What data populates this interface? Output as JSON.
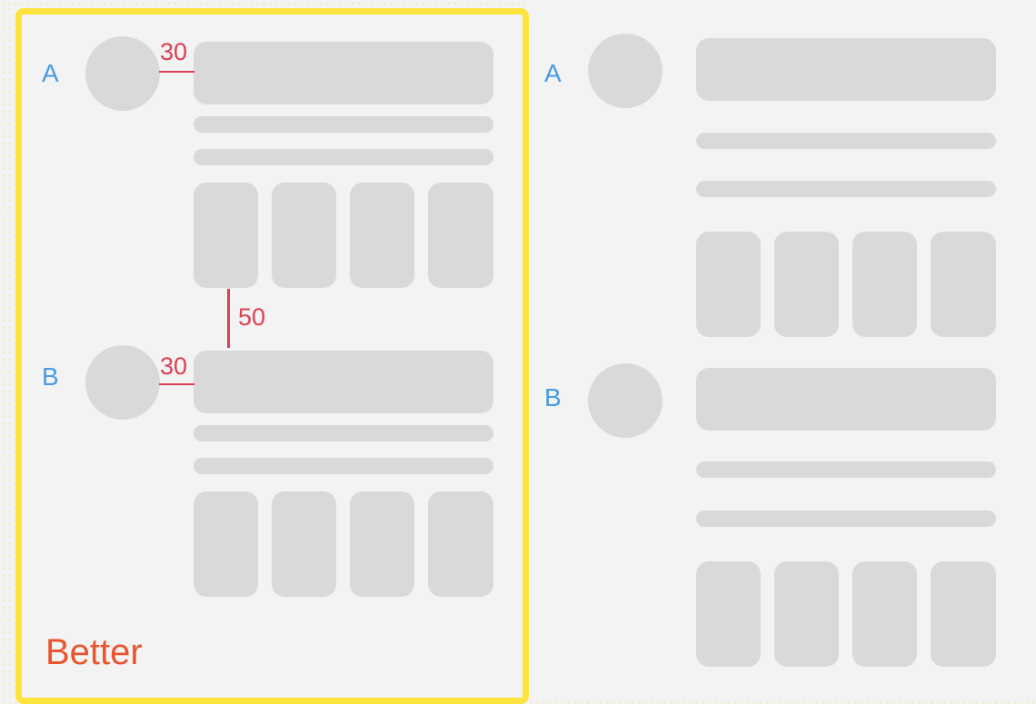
{
  "examples": {
    "left": {
      "verdict": "Better",
      "groups": [
        {
          "label": "A",
          "gap_label": "30"
        },
        {
          "label": "B",
          "gap_label": "30"
        }
      ],
      "between_groups_label": "50"
    },
    "right": {
      "groups": [
        {
          "label": "A"
        },
        {
          "label": "B"
        }
      ]
    }
  },
  "colors": {
    "placeholder": "#d9d9d9",
    "background": "#f3f3f3",
    "highlight_frame": "#fde33c",
    "group_label": "#4a9be3",
    "measurement": "#dc4055",
    "verdict": "#e8552e"
  }
}
